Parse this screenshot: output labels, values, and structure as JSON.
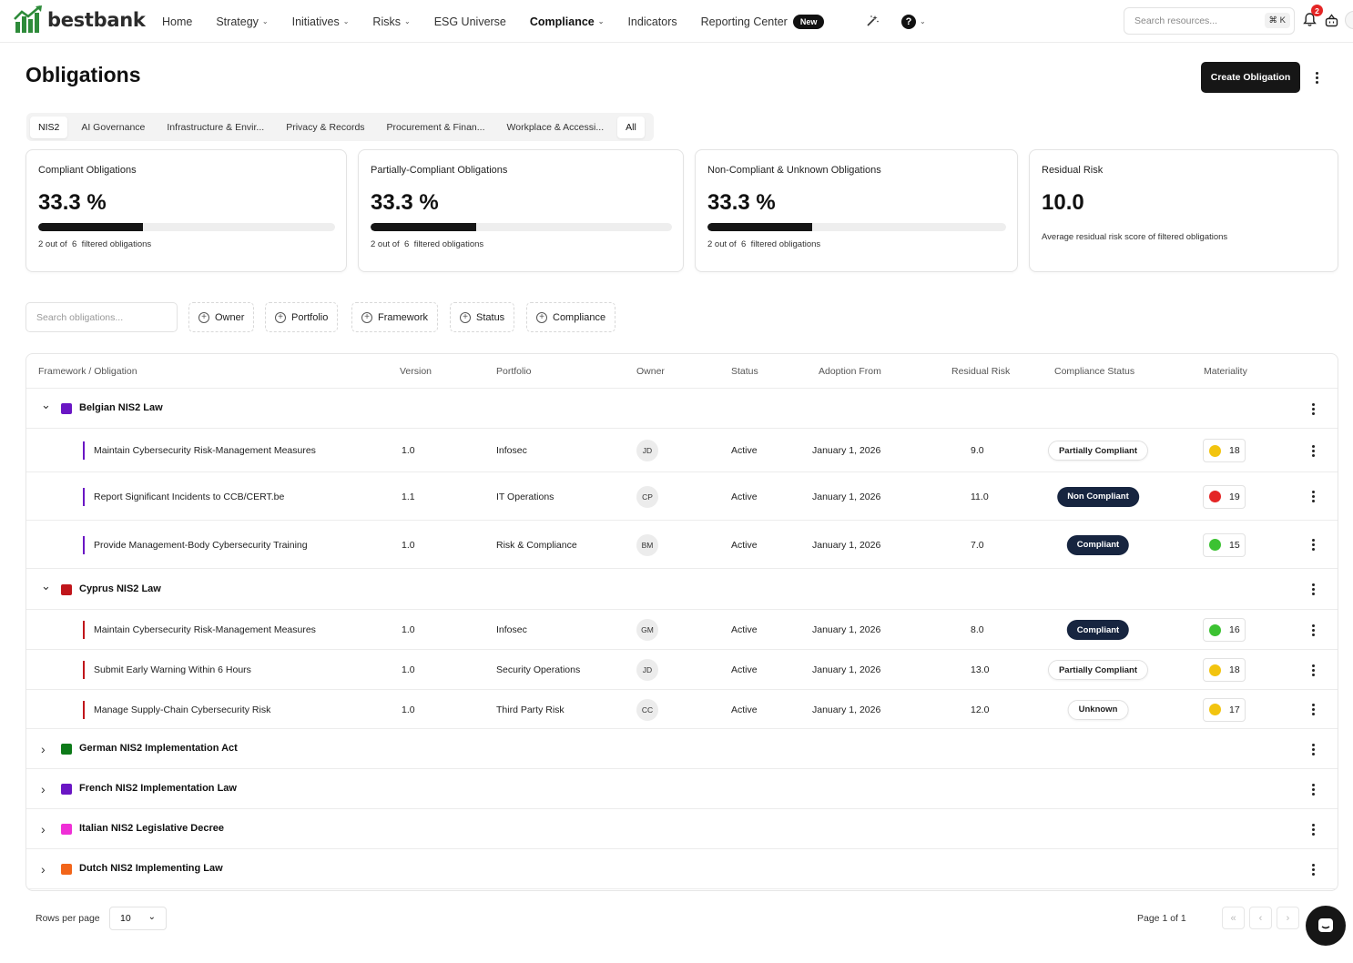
{
  "brand": {
    "name": "bestbank",
    "accent": "#2e8b3a"
  },
  "nav": {
    "items": [
      {
        "label": "Home",
        "dropdown": false
      },
      {
        "label": "Strategy",
        "dropdown": true
      },
      {
        "label": "Initiatives",
        "dropdown": true
      },
      {
        "label": "Risks",
        "dropdown": true
      },
      {
        "label": "ESG Universe",
        "dropdown": false
      },
      {
        "label": "Compliance",
        "dropdown": true,
        "active": true
      },
      {
        "label": "Indicators",
        "dropdown": false
      },
      {
        "label": "Reporting Center",
        "dropdown": false
      }
    ],
    "new_badge": "New",
    "search_placeholder": "Search resources...",
    "search_shortcut": "⌘ K",
    "notification_count": "2"
  },
  "page": {
    "title": "Obligations",
    "create_label": "Create Obligation"
  },
  "tabs": [
    {
      "label": "NIS2",
      "active": true
    },
    {
      "label": "AI Governance"
    },
    {
      "label": "Infrastructure & Envir..."
    },
    {
      "label": "Privacy & Records"
    },
    {
      "label": "Procurement & Finan..."
    },
    {
      "label": "Workplace & Accessi..."
    },
    {
      "label": "All",
      "active_white": true
    }
  ],
  "cards": [
    {
      "title": "Compliant Obligations",
      "value": "33.3 %",
      "progress": 0.353,
      "count": "2",
      "total": "6",
      "note_prefix": "2 out of",
      "note_suffix": "filtered obligations"
    },
    {
      "title": "Partially-Compliant Obligations",
      "value": "33.3 %",
      "progress": 0.35,
      "count": "2",
      "total": "6",
      "note_prefix": "2 out of",
      "note_suffix": "filtered obligations"
    },
    {
      "title": "Non-Compliant & Unknown Obligations",
      "value": "33.3 %",
      "progress": 0.35,
      "count": "2",
      "total": "6",
      "note_prefix": "2 out of",
      "note_suffix": "filtered obligations"
    },
    {
      "title": "Residual Risk",
      "value": "10.0",
      "note": "Average residual risk score of filtered obligations"
    }
  ],
  "filters": {
    "search_placeholder": "Search obligations...",
    "buttons": [
      "Owner",
      "Portfolio",
      "Framework",
      "Status",
      "Compliance"
    ]
  },
  "table": {
    "columns": [
      "Framework / Obligation",
      "Version",
      "Portfolio",
      "Owner",
      "Status",
      "Adoption From",
      "Residual Risk",
      "Compliance Status",
      "Materiality"
    ],
    "groups": [
      {
        "name": "Belgian NIS2 Law",
        "color": "#6a16c4",
        "expanded": true,
        "rows": [
          {
            "obligation": "Maintain Cybersecurity Risk-Management Measures",
            "version": "1.0",
            "portfolio": "Infosec",
            "owner": "JD",
            "status": "Active",
            "adoption": "January 1, 2026",
            "risk": "9.0",
            "compliance": "Partially Compliant",
            "compliance_style": "light",
            "materiality": "18",
            "materiality_color": "#f2c40f"
          },
          {
            "obligation": "Report Significant Incidents to CCB/CERT.be",
            "version": "1.1",
            "portfolio": "IT Operations",
            "owner": "CP",
            "status": "Active",
            "adoption": "January 1, 2026",
            "risk": "11.0",
            "compliance": "Non Compliant",
            "compliance_style": "dark",
            "materiality": "19",
            "materiality_color": "#e42525"
          },
          {
            "obligation": "Provide Management-Body Cybersecurity Training",
            "version": "1.0",
            "portfolio": "Risk & Compliance",
            "owner": "BM",
            "status": "Active",
            "adoption": "January 1, 2026",
            "risk": "7.0",
            "compliance": "Compliant",
            "compliance_style": "dark",
            "materiality": "15",
            "materiality_color": "#3cc232"
          }
        ]
      },
      {
        "name": "Cyprus NIS2 Law",
        "color": "#c0151b",
        "expanded": true,
        "rows": [
          {
            "obligation": "Maintain Cybersecurity Risk-Management Measures",
            "version": "1.0",
            "portfolio": "Infosec",
            "owner": "GM",
            "status": "Active",
            "adoption": "January 1, 2026",
            "risk": "8.0",
            "compliance": "Compliant",
            "compliance_style": "dark",
            "materiality": "16",
            "materiality_color": "#3cc232"
          },
          {
            "obligation": "Submit Early Warning Within 6 Hours",
            "version": "1.0",
            "portfolio": "Security Operations",
            "owner": "JD",
            "status": "Active",
            "adoption": "January 1, 2026",
            "risk": "13.0",
            "compliance": "Partially Compliant",
            "compliance_style": "light",
            "materiality": "18",
            "materiality_color": "#f2c40f"
          },
          {
            "obligation": "Manage Supply-Chain Cybersecurity Risk",
            "version": "1.0",
            "portfolio": "Third Party Risk",
            "owner": "CC",
            "status": "Active",
            "adoption": "January 1, 2026",
            "risk": "12.0",
            "compliance": "Unknown",
            "compliance_style": "light",
            "materiality": "17",
            "materiality_color": "#f2c40f"
          }
        ]
      },
      {
        "name": "German NIS2 Implementation Act",
        "color": "#0d7a19",
        "expanded": false,
        "rows": []
      },
      {
        "name": "French NIS2 Implementation Law",
        "color": "#6a16c4",
        "expanded": false,
        "rows": []
      },
      {
        "name": "Italian NIS2 Legislative Decree",
        "color": "#ef2fd6",
        "expanded": false,
        "rows": []
      },
      {
        "name": "Dutch NIS2 Implementing Law",
        "color": "#f2651a",
        "expanded": false,
        "rows": []
      }
    ]
  },
  "footer": {
    "rows_per_page_label": "Rows per page",
    "rows_per_page": "10",
    "page_info": "Page 1 of 1"
  }
}
